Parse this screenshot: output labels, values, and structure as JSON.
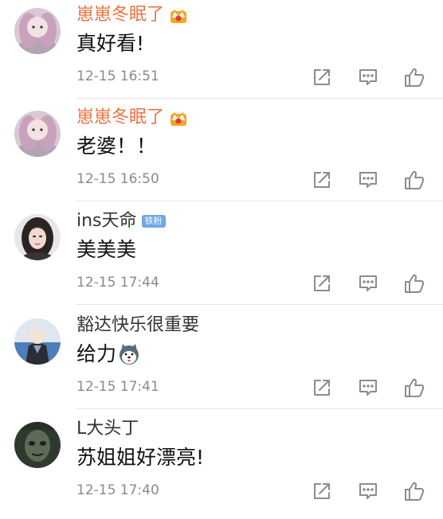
{
  "comments": [
    {
      "username": "崽崽冬眠了",
      "text": "真好看!",
      "timestamp": "12-15 16:51",
      "vip": true
    },
    {
      "username": "崽崽冬眠了",
      "text": "老婆！！",
      "timestamp": "12-15 16:50",
      "vip": true
    },
    {
      "username": "ins天命",
      "badge": "铁粉",
      "text": "美美美",
      "timestamp": "12-15 17:44"
    },
    {
      "username": "豁达快乐很重要",
      "text": "给力",
      "timestamp": "12-15 17:41",
      "emoji": "husky-emoji-icon"
    },
    {
      "username": "L大头丁",
      "text": "苏姐姐好漂亮!",
      "timestamp": "12-15 17:40"
    }
  ],
  "actions": {
    "forward_icon": "forward-icon",
    "comment_icon": "comment-icon",
    "like_icon": "like-icon"
  },
  "colors": {
    "vip_name": "#eb7340",
    "normal_name": "#333333",
    "timestamp": "#8a8a8a",
    "badge": "#6fa7e6"
  }
}
